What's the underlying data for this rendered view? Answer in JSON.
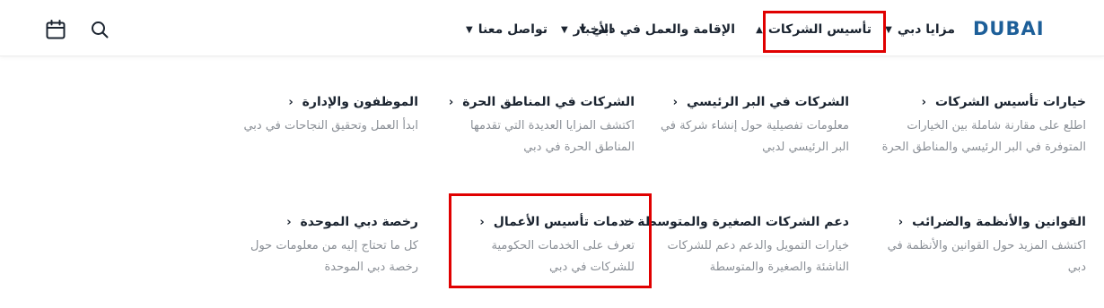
{
  "header": {
    "logo_text": "DUBAI",
    "nav": [
      {
        "label": "مزايا دبي",
        "chevron": "down"
      },
      {
        "label": "تأسيس الشركات",
        "chevron": "up"
      },
      {
        "label": "الإقامة والعمل في دبي",
        "chevron": "down"
      },
      {
        "label": "الأخبار",
        "chevron": "down"
      },
      {
        "label": "تواصل معنا",
        "chevron": "down"
      }
    ],
    "icons": [
      "search-icon",
      "calendar-icon"
    ]
  },
  "menu": {
    "row1": [
      {
        "title": "خيارات تأسيس الشركات",
        "desc": "اطلع على مقارنة شاملة بين الخيارات المتوفرة في البر الرئيسي والمناطق الحرة"
      },
      {
        "title": "الشركات في البر الرئيسي",
        "desc": "معلومات تفصيلية حول إنشاء شركة في البر الرئيسي لدبي"
      },
      {
        "title": "الشركات في المناطق الحرة",
        "desc": "اكتشف المزايا العديدة التي تقدمها المناطق الحرة في دبي"
      },
      {
        "title": "الموظفون والإدارة",
        "desc": "ابدأ العمل وتحقيق النجاحات في دبي"
      }
    ],
    "row2": [
      {
        "title": "القوانين والأنظمة والضرائب",
        "desc": "اكتشف المزيد حول القوانين والأنظمة في دبي"
      },
      {
        "title": "دعم الشركات الصغيرة والمتوسطة",
        "desc": "خيارات التمويل والدعم دعم للشركات الناشئة والصغيرة والمتوسطة"
      },
      {
        "title": "خدمات تأسيس الأعمال",
        "desc": "تعرف على الخدمات الحكومية للشركات في دبي"
      },
      {
        "title": "رخصة دبي الموحدة",
        "desc": "كل ما تحتاج إليه من معلومات حول رخصة دبي الموحدة"
      }
    ]
  },
  "colors": {
    "highlight": "#e00000",
    "logo": "#1d5f99",
    "text": "#1b2430",
    "muted": "#8a8f96"
  }
}
